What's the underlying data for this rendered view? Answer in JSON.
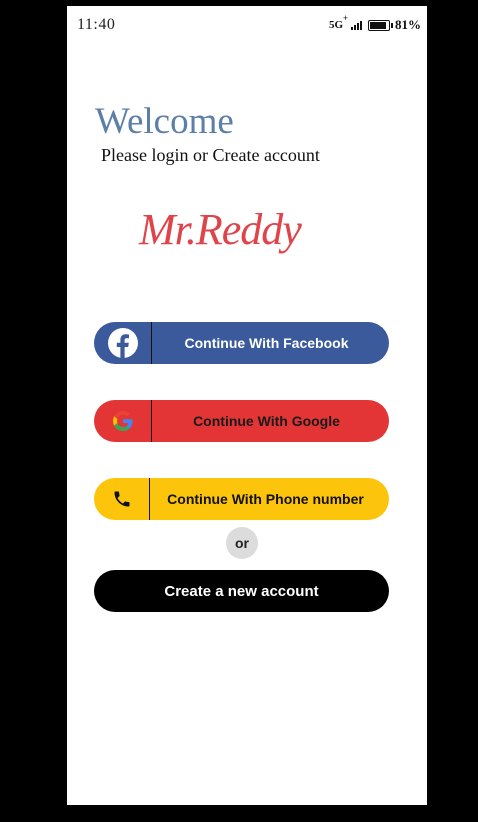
{
  "status_bar": {
    "time": "11:40",
    "network": "5G",
    "network_plus": "+",
    "battery": "81%",
    "battery_level": 0.81
  },
  "welcome": {
    "title": "Welcome",
    "subtitle": "Please login or Create account"
  },
  "brand": {
    "logo_text": "Mr.Reddy"
  },
  "auth": {
    "facebook_label": "Continue With Facebook",
    "google_label": "Continue With Google",
    "phone_label": "Continue With Phone number",
    "or_label": "or",
    "create_label": "Create a new account"
  },
  "icons": {
    "facebook": "facebook-icon",
    "google": "google-icon",
    "phone": "phone-icon"
  },
  "colors": {
    "welcome": "#5b7fa6",
    "brand": "#e0444b",
    "facebook": "#3a5a9b",
    "google": "#e33535",
    "phone": "#fcc40b",
    "create": "#000000"
  }
}
